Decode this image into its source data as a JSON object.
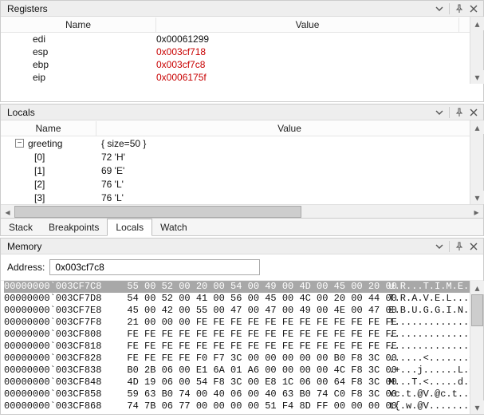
{
  "registers_panel": {
    "title": "Registers",
    "name_header": "Name",
    "value_header": "Value",
    "rows": [
      {
        "name": "edi",
        "value": "0x00061299",
        "changed": false
      },
      {
        "name": "esp",
        "value": "0x003cf718",
        "changed": true
      },
      {
        "name": "ebp",
        "value": "0x003cf7c8",
        "changed": true
      },
      {
        "name": "eip",
        "value": "0x0006175f",
        "changed": true
      }
    ]
  },
  "locals_panel": {
    "title": "Locals",
    "name_header": "Name",
    "value_header": "Value",
    "rows": [
      {
        "kind": "parent",
        "name": "greeting",
        "value": "{ size=50 }"
      },
      {
        "kind": "child",
        "name": "[0]",
        "value": "72 'H'"
      },
      {
        "kind": "child",
        "name": "[1]",
        "value": "69 'E'"
      },
      {
        "kind": "child",
        "name": "[2]",
        "value": "76 'L'"
      },
      {
        "kind": "child",
        "name": "[3]",
        "value": "76 'L'"
      }
    ],
    "tabs": [
      {
        "label": "Stack",
        "active": false
      },
      {
        "label": "Breakpoints",
        "active": false
      },
      {
        "label": "Locals",
        "active": true
      },
      {
        "label": "Watch",
        "active": false
      }
    ]
  },
  "memory_panel": {
    "title": "Memory",
    "address_label": "Address:",
    "address_value": "0x003cf7c8",
    "lines": [
      {
        "addr": "00000000`003CF7C8",
        "hex": "55 00 52 00 20 00 54 00 49 00 4D 00 45 00 20 00",
        "asc": "U.R...T.I.M.E...",
        "selected": true
      },
      {
        "addr": "00000000`003CF7D8",
        "hex": "54 00 52 00 41 00 56 00 45 00 4C 00 20 00 44 00",
        "asc": "T.R.A.V.E.L...D."
      },
      {
        "addr": "00000000`003CF7E8",
        "hex": "45 00 42 00 55 00 47 00 47 00 49 00 4E 00 47 00",
        "asc": "E.B.U.G.G.I.N.G."
      },
      {
        "addr": "00000000`003CF7F8",
        "hex": "21 00 00 00 FE FE FE FE FE FE FE FE FE FE FE FE",
        "asc": "!..............."
      },
      {
        "addr": "00000000`003CF808",
        "hex": "FE FE FE FE FE FE FE FE FE FE FE FE FE FE FE FE",
        "asc": "................"
      },
      {
        "addr": "00000000`003CF818",
        "hex": "FE FE FE FE FE FE FE FE FE FE FE FE FE FE FE FE",
        "asc": "................"
      },
      {
        "addr": "00000000`003CF828",
        "hex": "FE FE FE FE F0 F7 3C 00 00 00 00 00 B0 F8 3C 00",
        "asc": "......<.......<."
      },
      {
        "addr": "00000000`003CF838",
        "hex": "B0 2B 06 00 E1 6A 01 A6 00 00 00 00 4C F8 3C 00",
        "asc": ".+...j......L.<."
      },
      {
        "addr": "00000000`003CF848",
        "hex": "4D 19 06 00 54 F8 3C 00 E8 1C 06 00 64 F8 3C 00",
        "asc": "M...T.<.....d.<."
      },
      {
        "addr": "00000000`003CF858",
        "hex": "59 63 B0 74 00 40 06 00 40 63 B0 74 C0 F8 3C 00",
        "asc": "Yc.t.@V.@c.t..<."
      },
      {
        "addr": "00000000`003CF868",
        "hex": "74 7B 06 77 00 00 00 00 51 F4 8D FF 00 00 00 00",
        "asc": "t{.w.@V........."
      }
    ]
  }
}
